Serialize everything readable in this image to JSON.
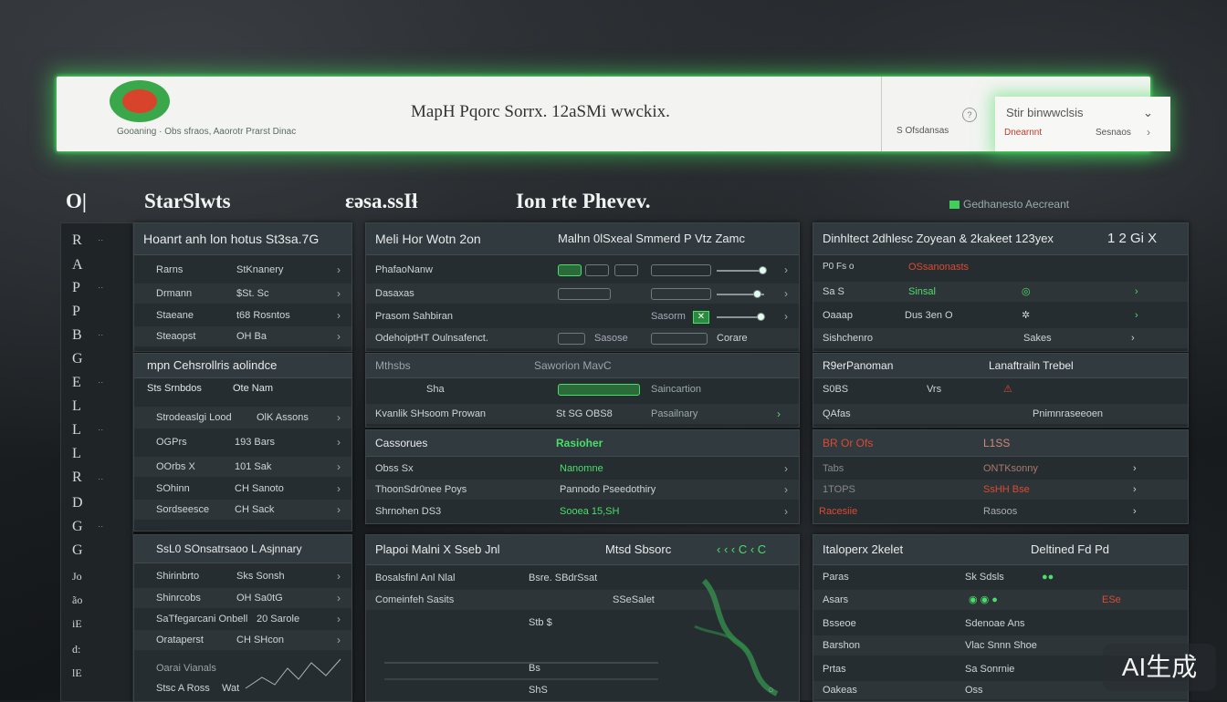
{
  "header": {
    "brand_line": "Gooaning · Obs sfraos, Aaorotr Prarst Dinac",
    "title": "MapH  Pqorc Sorrx. 12aSMi wwckix.",
    "right_meta": "S Ofsdansas",
    "popout": {
      "title": "Stir binwwclsis",
      "alert": "Dnearnnt",
      "info": "Sesnaos",
      "chev": "⌄"
    }
  },
  "sections": {
    "h_left_code": "O|",
    "h_left": "StarSlwts",
    "h_mid_left": "ɛǝsa.ssIɬ",
    "h_mid": "Ion rte Phevev.",
    "h_right": "Gedhanesto Aecreant"
  },
  "rail": {
    "chars": [
      "R",
      "A",
      "P",
      "P",
      "B",
      "G",
      "E",
      "L",
      "L",
      "L",
      "R",
      "D",
      "G",
      "G"
    ],
    "chars2": [
      "Jo",
      "ão",
      "iE",
      "d:",
      "lE"
    ]
  },
  "p1": {
    "title": "Hoanrt anh lon hotus  St3sa.7G",
    "rows": [
      [
        "Rarns",
        "StKnanery"
      ],
      [
        "Drmann",
        "$St. Sc"
      ],
      [
        "Staeane",
        "t68 Rosntos"
      ],
      [
        "Steaopst",
        "OH Ba"
      ]
    ]
  },
  "p2": {
    "title": "mpn Cehsrollris aolindce",
    "head_row": [
      "Sts Srnbdos",
      "Ote Nam"
    ],
    "rows": [
      [
        "Strodeaslgi Lood",
        "OlK Assons"
      ],
      [
        "OGPrs",
        "193 Bars"
      ],
      [
        "OOrbs   X",
        "101 Sak"
      ],
      [
        "SOhinn",
        "CH Sanoto"
      ],
      [
        "Sordseesce",
        "CH Sack"
      ]
    ]
  },
  "p3": {
    "title": "SsL0 SOnsatrsaoo L Asjnnary",
    "rows": [
      [
        "Shirinbrto",
        "Sks Sonsh"
      ],
      [
        "Shinrcobs",
        "OH Sa0tG"
      ],
      [
        "SaTfegarcani Onbell",
        "20 Sarole"
      ],
      [
        "Orataperst",
        "CH SHcon"
      ],
      [
        "Oarai Vianals",
        ""
      ],
      [
        "Stsc A Ross",
        "Wat"
      ]
    ]
  },
  "p4": {
    "title": "Meli Hor Wotn 2on",
    "title_right": "Malhn 0lSxeal  Smmerd P  Vtz Zamc",
    "rows": [
      [
        "PhafaoNanw",
        ""
      ],
      [
        "Dasaxas",
        ""
      ],
      [
        "Prasom    Sahbiran",
        ""
      ],
      [
        "OdehoiptHT  Oulnsafenct.",
        "Corare"
      ]
    ],
    "sub_labels": [
      "Sasorm",
      "Sasose",
      "Sasose"
    ]
  },
  "p5": {
    "title": "Mthsbs",
    "title_mid": "Saworion MavC",
    "rows": [
      [
        "Sha",
        "Saincartion"
      ],
      [
        "Kvanlik    SHsoom Prowan",
        "St SG OBS8"
      ]
    ],
    "extra": "Pasailnary"
  },
  "p6": {
    "title": "Cassorues",
    "title_right": "Rasioher",
    "rows": [
      [
        "Obss   Sx",
        "Nanomne"
      ],
      [
        "ThoonSdr0nee Poys",
        "Pannodo  Pseedothiry"
      ],
      [
        "Shrnohen   DS3",
        "Sooea  15,SH"
      ]
    ]
  },
  "p7": {
    "title": "Plapoi   Malni  X   Sseb  Jnl",
    "title_mid": "Mtsd Sbsorc",
    "rows": [
      [
        "Bosalsfinl Anl Nlal",
        "Bsre.   SBdrSsat"
      ],
      [
        "Comeinfeh Sasits",
        "SSeSalet"
      ],
      [
        "",
        "Stb   $"
      ],
      [
        "",
        "Bs"
      ],
      [
        "",
        "ShS"
      ]
    ]
  },
  "p8": {
    "title": "Dinhltect  2dhlesc  Zoyean & 2kakeet  123yex",
    "title_right": "1  2  Gi  X",
    "rows": [
      [
        "P0 Fs o",
        "OSsanonasts"
      ],
      [
        "Sa  S",
        "Sinsal"
      ],
      [
        "Oaaap",
        "Dus 3en   O"
      ],
      [
        "Sishchenro",
        "Sakes"
      ]
    ]
  },
  "p9": {
    "title": "R9erPanoman",
    "title_right": "Lanaftrailn Trebel",
    "rows": [
      [
        "S0BS",
        "Vrs"
      ],
      [
        "QAfas",
        "Pnimnraseeoen"
      ]
    ]
  },
  "p10": {
    "title": "BR  Or   Ofs",
    "title_right": "L1SS",
    "rows": [
      [
        "Tabs",
        "ONTKsonny"
      ],
      [
        "1TOPS",
        "SsHH Bse"
      ],
      [
        "Racesiie",
        "Rasoos"
      ]
    ]
  },
  "p11": {
    "title": "Italoperx  2kelet",
    "title_right": "Deltined  Fd  Pd",
    "rows": [
      [
        "Paras",
        "Sk Sdsls"
      ],
      [
        "Asars",
        "ESe"
      ],
      [
        "Bsseoe",
        "Sdenoae  Ans"
      ],
      [
        "Barshon",
        "Vlac Snnn  Shoe"
      ],
      [
        "Prtas",
        "Sa  Sonrnie"
      ],
      [
        "Oakeas",
        "Oss"
      ]
    ]
  },
  "watermark": "AI生成"
}
